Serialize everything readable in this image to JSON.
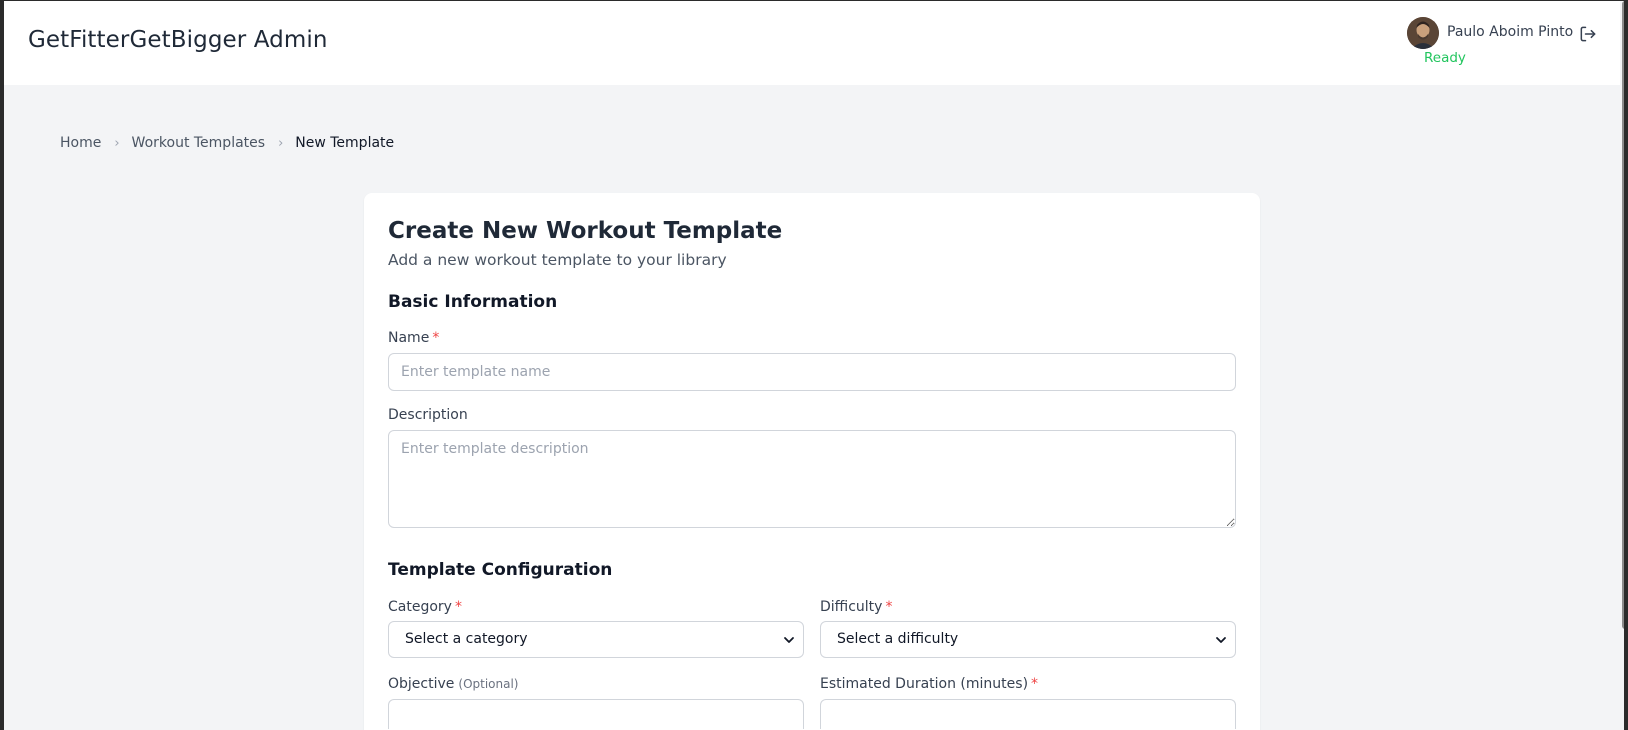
{
  "header": {
    "app_title": "GetFitterGetBigger Admin",
    "user_name": "Paulo Aboim Pinto",
    "status": "Ready",
    "avatar_icon": "user-avatar",
    "logout_icon": "logout-icon"
  },
  "breadcrumb": {
    "items": [
      "Home",
      "Workout Templates"
    ],
    "current": "New Template",
    "separator": "›"
  },
  "form": {
    "title": "Create New Workout Template",
    "subtitle": "Add a new workout template to your library",
    "basic_section": "Basic Information",
    "name_label": "Name",
    "name_required": "*",
    "name_placeholder": "Enter template name",
    "description_label": "Description",
    "description_placeholder": "Enter template description",
    "config_section": "Template Configuration",
    "category_label": "Category",
    "category_required": "*",
    "category_value": "Select a category",
    "difficulty_label": "Difficulty",
    "difficulty_required": "*",
    "difficulty_value": "Select a difficulty",
    "objective_label": "Objective",
    "objective_optional": "(Optional)",
    "duration_label": "Estimated Duration (minutes)",
    "duration_required": "*"
  },
  "colors": {
    "accent_status": "#22c55e",
    "required": "#ef4444",
    "background": "#f3f4f6",
    "card": "#ffffff"
  }
}
